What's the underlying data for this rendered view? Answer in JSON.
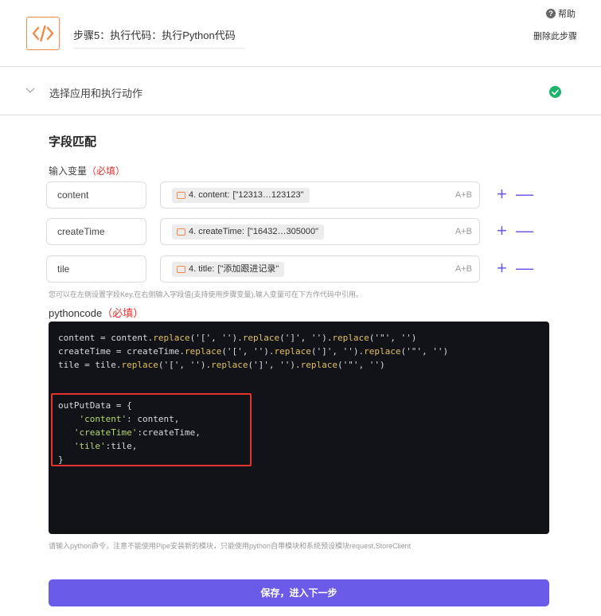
{
  "header": {
    "step_title": "步骤5：执行代码：执行Python代码",
    "help_label": "帮助",
    "delete_label": "删除此步骤"
  },
  "app_section": {
    "label": "选择应用和执行动作",
    "status_color": "#1cb36a"
  },
  "field_mapping": {
    "title": "字段匹配",
    "input_var_label": "输入变量",
    "required_label": "（必填）",
    "rows": [
      {
        "key": "content",
        "chip_label": "4. content:",
        "chip_value": "[\"12313…123123\"",
        "ab_label": "A+B"
      },
      {
        "key": "createTime",
        "chip_label": "4. createTime:",
        "chip_value": "[\"16432…305000\"",
        "ab_label": "A+B"
      },
      {
        "key": "tile",
        "chip_label": "4. title:",
        "chip_value": "[\"添加跟进记录\"",
        "ab_label": "A+B"
      }
    ],
    "hint": "您可以在左侧设置字段Key,在右侧输入字段值(支持使用步骤变量),输入变量可在下方作代码中引用。"
  },
  "pythoncode": {
    "label": "pythoncode",
    "required_label": "（必填）",
    "lines": [
      "content = content.replace('[', '').replace(']', '').replace('\"', '')",
      "createTime = createTime.replace('[', '').replace(']', '').replace('\"', '')",
      "tile = tile.replace('[', '').replace(']', '').replace('\"', '')",
      "",
      "",
      "outPutData = {",
      "    'content': content,",
      "   'createTime':createTime,",
      "   'tile':tile,",
      "}"
    ],
    "hint": "请输入python命令，注意不能使用Pipe安装新的模块，只能使用python自带模块和系统预设模块request,StoreClient"
  },
  "save_button": {
    "label": "保存，进入下一步",
    "color": "#6a5ce8"
  },
  "colors": {
    "accent": "#6a5ce8",
    "icon_orange": "#f08a4b",
    "required_red": "#e5322d",
    "code_bg": "#111318"
  }
}
